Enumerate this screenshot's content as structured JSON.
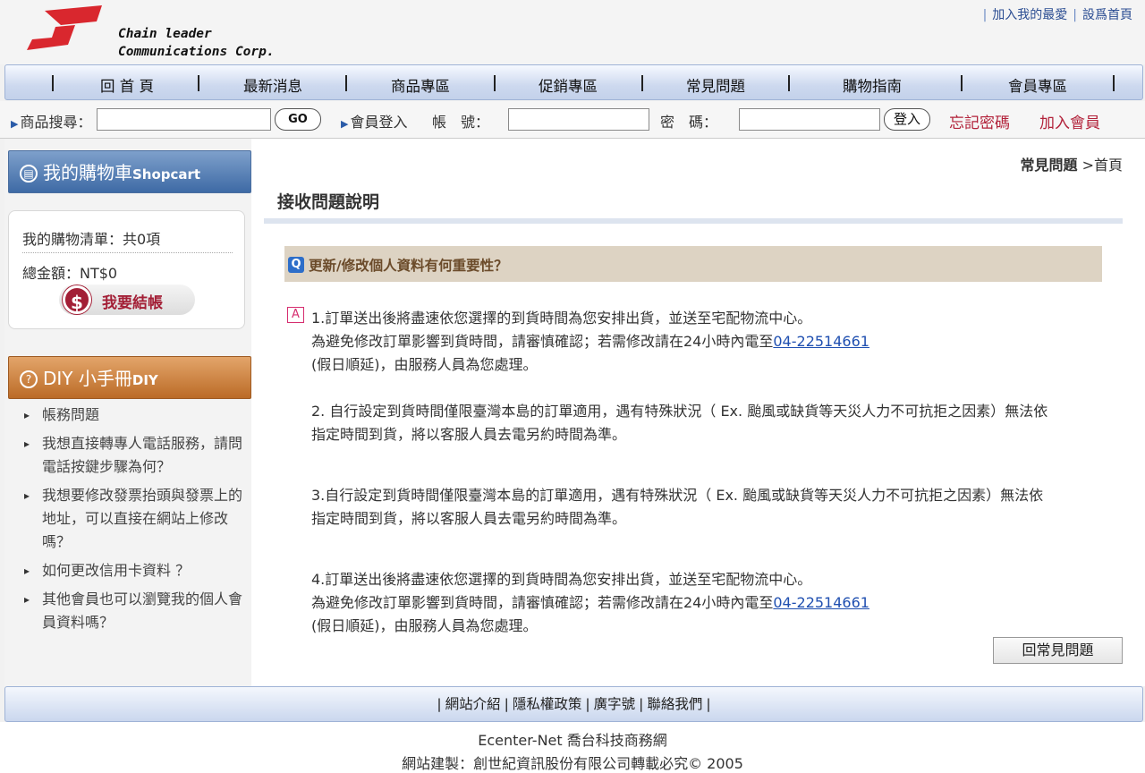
{
  "header": {
    "logo_lines": "Chain leader\nCommunications Corp.",
    "top_links": [
      "加入我的最愛",
      "設爲首頁"
    ]
  },
  "nav": {
    "items": [
      "回 首 頁",
      "最新消息",
      "商品專區",
      "促銷專區",
      "常見問題",
      "購物指南",
      "會員專區"
    ]
  },
  "search_bar": {
    "search_label": "商品搜尋：",
    "go_label": "GO",
    "login_label": "會員登入",
    "account_label": "帳　號：",
    "password_label": "密　碼：",
    "login_button": "登入",
    "forgot_password": "忘記密碼",
    "join_member": "加入會員"
  },
  "sidebar": {
    "cart_title": "我的購物車",
    "cart_title_en": "Shopcart",
    "cart_list": "我的購物清單：共0項",
    "cart_total": "總金額：NT$0",
    "checkout_label": "我要結帳",
    "checkout_icon": "$",
    "diy_title": "DIY 小手冊",
    "diy_title_en": "DIY",
    "faq_items": [
      "帳務問題",
      "我想直接轉專人電話服務，請問電話按鍵步驟為何？",
      "我想要修改發票抬頭與發票上的地址，可以直接在網站上修改嗎？",
      "如何更改信用卡資料 ？",
      "其他會員也可以瀏覽我的個人會員資料嗎？"
    ]
  },
  "main": {
    "breadcrumb_current": "常見問題",
    "breadcrumb_sep": " >",
    "breadcrumb_home": "首頁",
    "page_title": "接收問題說明",
    "question_badge": "Q",
    "question": "更新/修改個人資料有何重要性？",
    "answer_badge": "A",
    "answers": {
      "p1_l1": "1.訂單送出後將盡速依您選擇的到貨時間為您安排出貨，並送至宅配物流中心。",
      "p1_l2": "為避免修改訂單影響到貨時間，請審慎確認；若需修改請在24小時內電至",
      "p1_phone": "04-22514661",
      "p1_l3": "(假日順延)，由服務人員為您處理。",
      "p2_l1": "2. 自行設定到貨時間僅限臺灣本島的訂單適用，遇有特殊狀況（ Ex. 颱風或缺貨等天災人力不可抗拒之因素）無法依",
      "p2_l2": "指定時間到貨，將以客服人員去電另約時間為準。",
      "p3_l1": "3.自行設定到貨時間僅限臺灣本島的訂單適用，遇有特殊狀況（ Ex. 颱風或缺貨等天災人力不可抗拒之因素）無法依",
      "p3_l2": "指定時間到貨，將以客服人員去電另約時間為準。",
      "p4_l1": "4.訂單送出後將盡速依您選擇的到貨時間為您安排出貨，並送至宅配物流中心。",
      "p4_l2": "為避免修改訂單影響到貨時間，請審慎確認；若需修改請在24小時內電至",
      "p4_phone": "04-22514661",
      "p4_l3": "(假日順延)，由服務人員為您處理。"
    },
    "back_button": "回常見問題"
  },
  "footer": {
    "links": [
      "網站介紹",
      "隱私權政策",
      "廣字號",
      "聯絡我們"
    ],
    "company": "Ecenter-Net 喬台科技商務網",
    "copyright": "網站建製：創世紀資訊股份有限公司轉載必究© 2005"
  },
  "colors": {
    "nav_blue": "#c3d1ea",
    "link_blue": "#1f4fb0",
    "brand_red": "#b2223a",
    "question_bg": "#ddd3c3"
  }
}
